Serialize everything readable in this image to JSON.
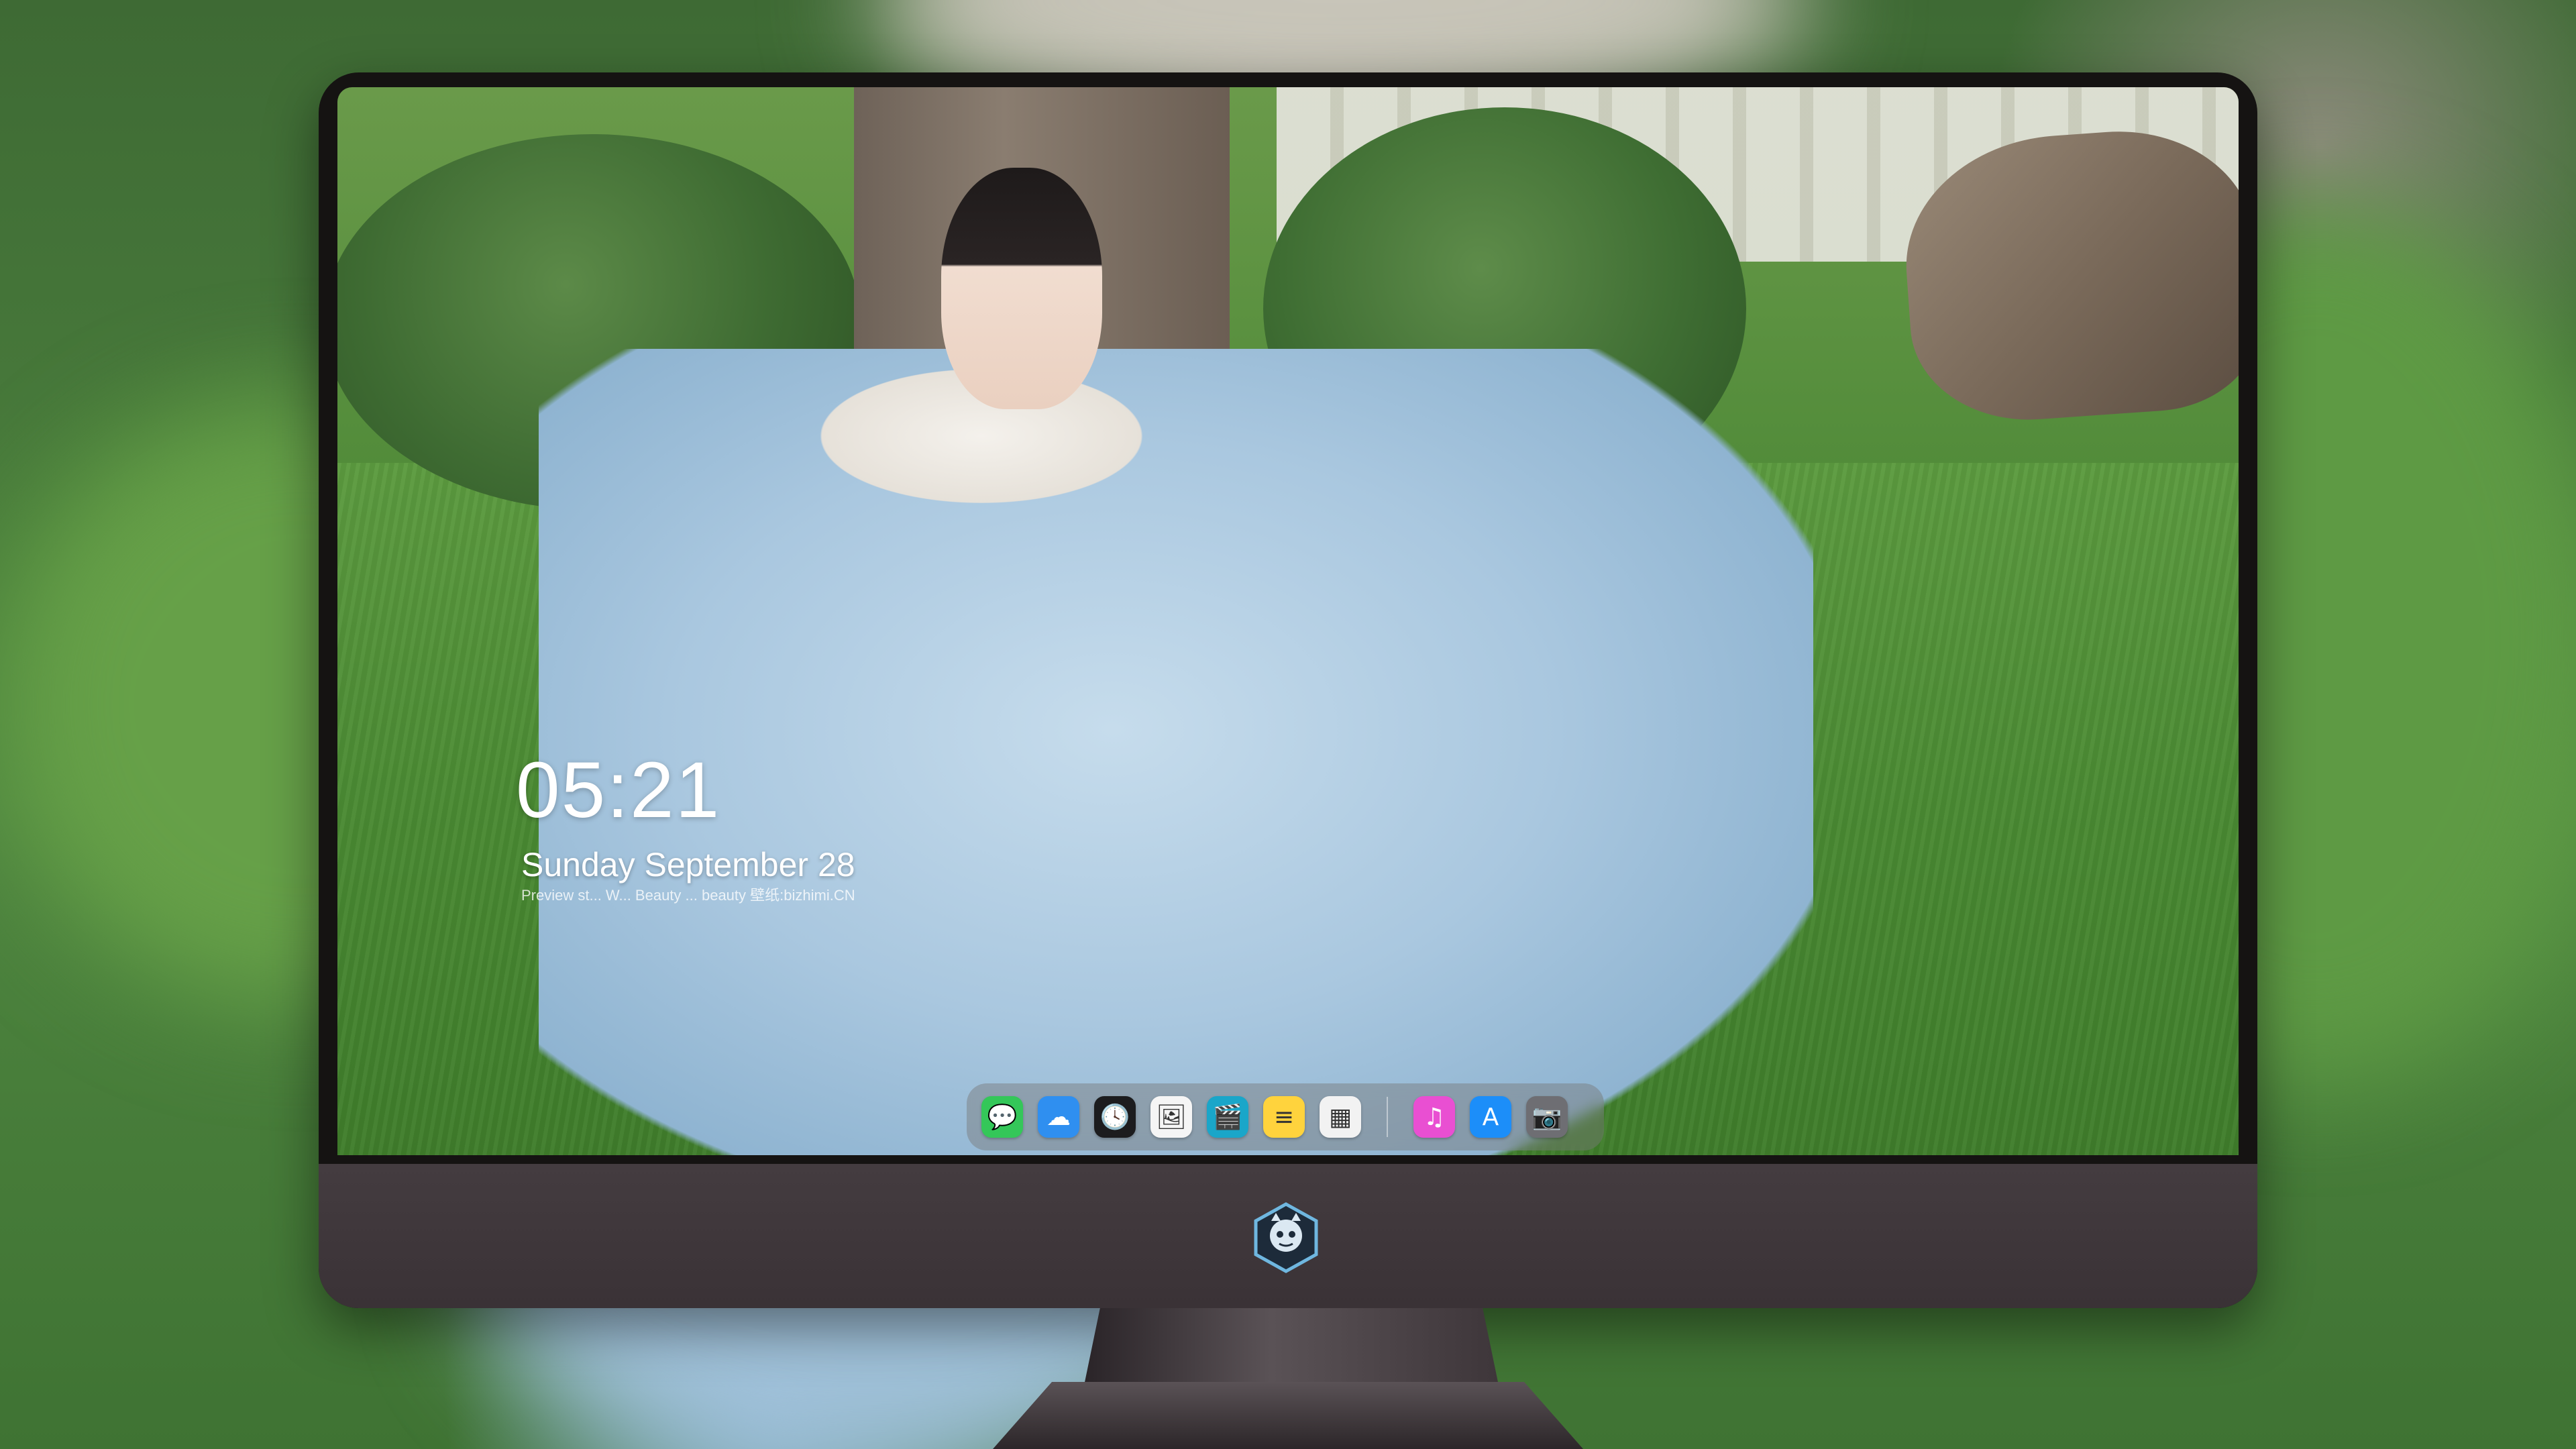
{
  "lock_screen": {
    "time": "05:21",
    "date": "Sunday  September   28",
    "caption": "Preview st... W... Beauty ... beauty  壁纸:bizhimi.CN"
  },
  "dock": {
    "apps": [
      {
        "name": "messages-icon",
        "glyph": "💬",
        "color": "#34c759"
      },
      {
        "name": "weather-icon",
        "glyph": "☁",
        "color": "#2f8ff0"
      },
      {
        "name": "clock-icon",
        "glyph": "🕓",
        "color": "#1c1c1e"
      },
      {
        "name": "preview-icon",
        "glyph": "🖼",
        "color": "#f5f5f5"
      },
      {
        "name": "claquette-icon",
        "glyph": "🎬",
        "color": "#1aa6c9"
      },
      {
        "name": "notes-icon",
        "glyph": "≡",
        "color": "#ffd33d"
      },
      {
        "name": "photo-booth-icon",
        "glyph": "▦",
        "color": "#f2f2f2"
      },
      {
        "name": "music-icon",
        "glyph": "♫",
        "color": "#e94fd2"
      },
      {
        "name": "app-store-icon",
        "glyph": "A",
        "color": "#1c8ef9"
      },
      {
        "name": "camera-icon",
        "glyph": "📷",
        "color": "#6e6e73"
      }
    ]
  },
  "colors": {
    "monitor_bezel": "#151312",
    "monitor_chin": "#3e3639",
    "dock_bg": "rgba(120,120,120,0.45)"
  }
}
